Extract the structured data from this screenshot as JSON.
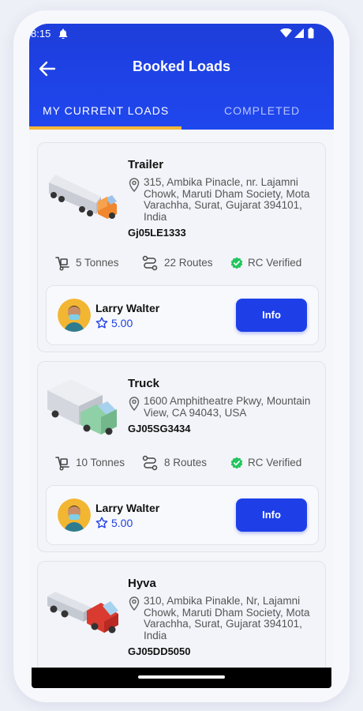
{
  "status_bar": {
    "time": "8:15"
  },
  "header": {
    "title": "Booked Loads"
  },
  "tabs": [
    {
      "label": "MY CURRENT LOADS",
      "active": true
    },
    {
      "label": "COMPLETED",
      "active": false
    }
  ],
  "colors": {
    "primary": "#1e3fe0",
    "tab_indicator": "#f3b637",
    "verified": "#22c55e"
  },
  "loads": [
    {
      "vehicle_type": "Trailer",
      "address": "315, Ambika Pinacle, nr. Lajamni Chowk, Maruti Dham Society, Mota Varachha, Surat, Gujarat 394101, India",
      "registration": "Gj05LE1333",
      "capacity": "5 Tonnes",
      "routes": "22 Routes",
      "verification": "RC Verified",
      "driver": {
        "name": "Larry Walter",
        "rating": "5.00"
      },
      "button_label": "Info"
    },
    {
      "vehicle_type": "Truck",
      "address": "1600 Amphitheatre Pkwy, Mountain View, CA 94043, USA",
      "registration": "GJ05SG3434",
      "capacity": "10 Tonnes",
      "routes": "8 Routes",
      "verification": "RC Verified",
      "driver": {
        "name": "Larry Walter",
        "rating": "5.00"
      },
      "button_label": "Info"
    },
    {
      "vehicle_type": "Hyva",
      "address": "310, Ambika Pinakle, Nr, Lajamni Chowk, Maruti Dham Society, Mota Varachha, Surat, Gujarat 394101, India",
      "registration": "GJ05DD5050"
    }
  ]
}
